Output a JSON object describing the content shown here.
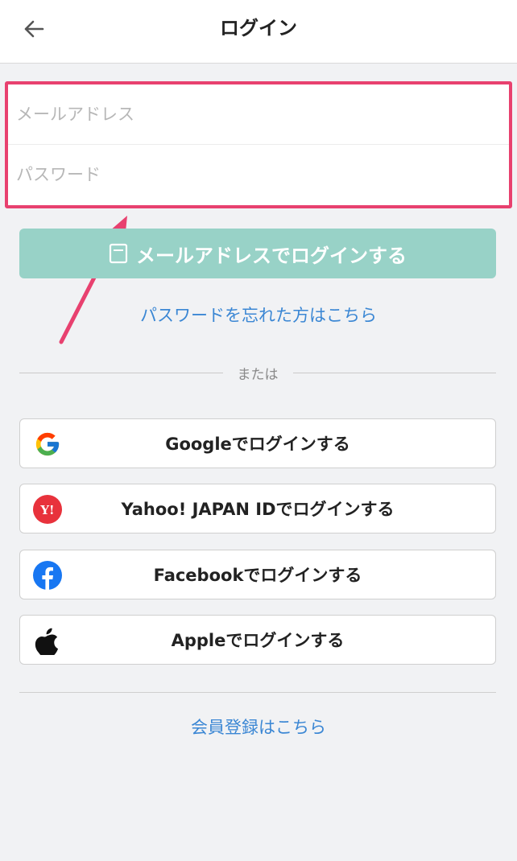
{
  "header": {
    "title": "ログイン"
  },
  "form": {
    "email_placeholder": "メールアドレス",
    "password_placeholder": "パスワード"
  },
  "mail_login": {
    "label": "メールアドレスでログインする"
  },
  "forgot_password": {
    "label": "パスワードを忘れた方はこちら"
  },
  "divider": {
    "label": "または"
  },
  "social": {
    "google": {
      "label": "Googleでログインする",
      "icon": "google-icon"
    },
    "yahoo": {
      "label": "Yahoo! JAPAN IDでログインする",
      "icon": "yahoo-japan-icon",
      "icon_text": "Y!"
    },
    "facebook": {
      "label": "Facebookでログインする",
      "icon": "facebook-icon"
    },
    "apple": {
      "label": "Appleでログインする",
      "icon": "apple-icon"
    }
  },
  "signup": {
    "label": "会員登録はこちら"
  },
  "colors": {
    "highlight": "#e8416f",
    "primary_button": "#98d2c7",
    "link": "#3b87d4",
    "background": "#f1f2f4"
  }
}
